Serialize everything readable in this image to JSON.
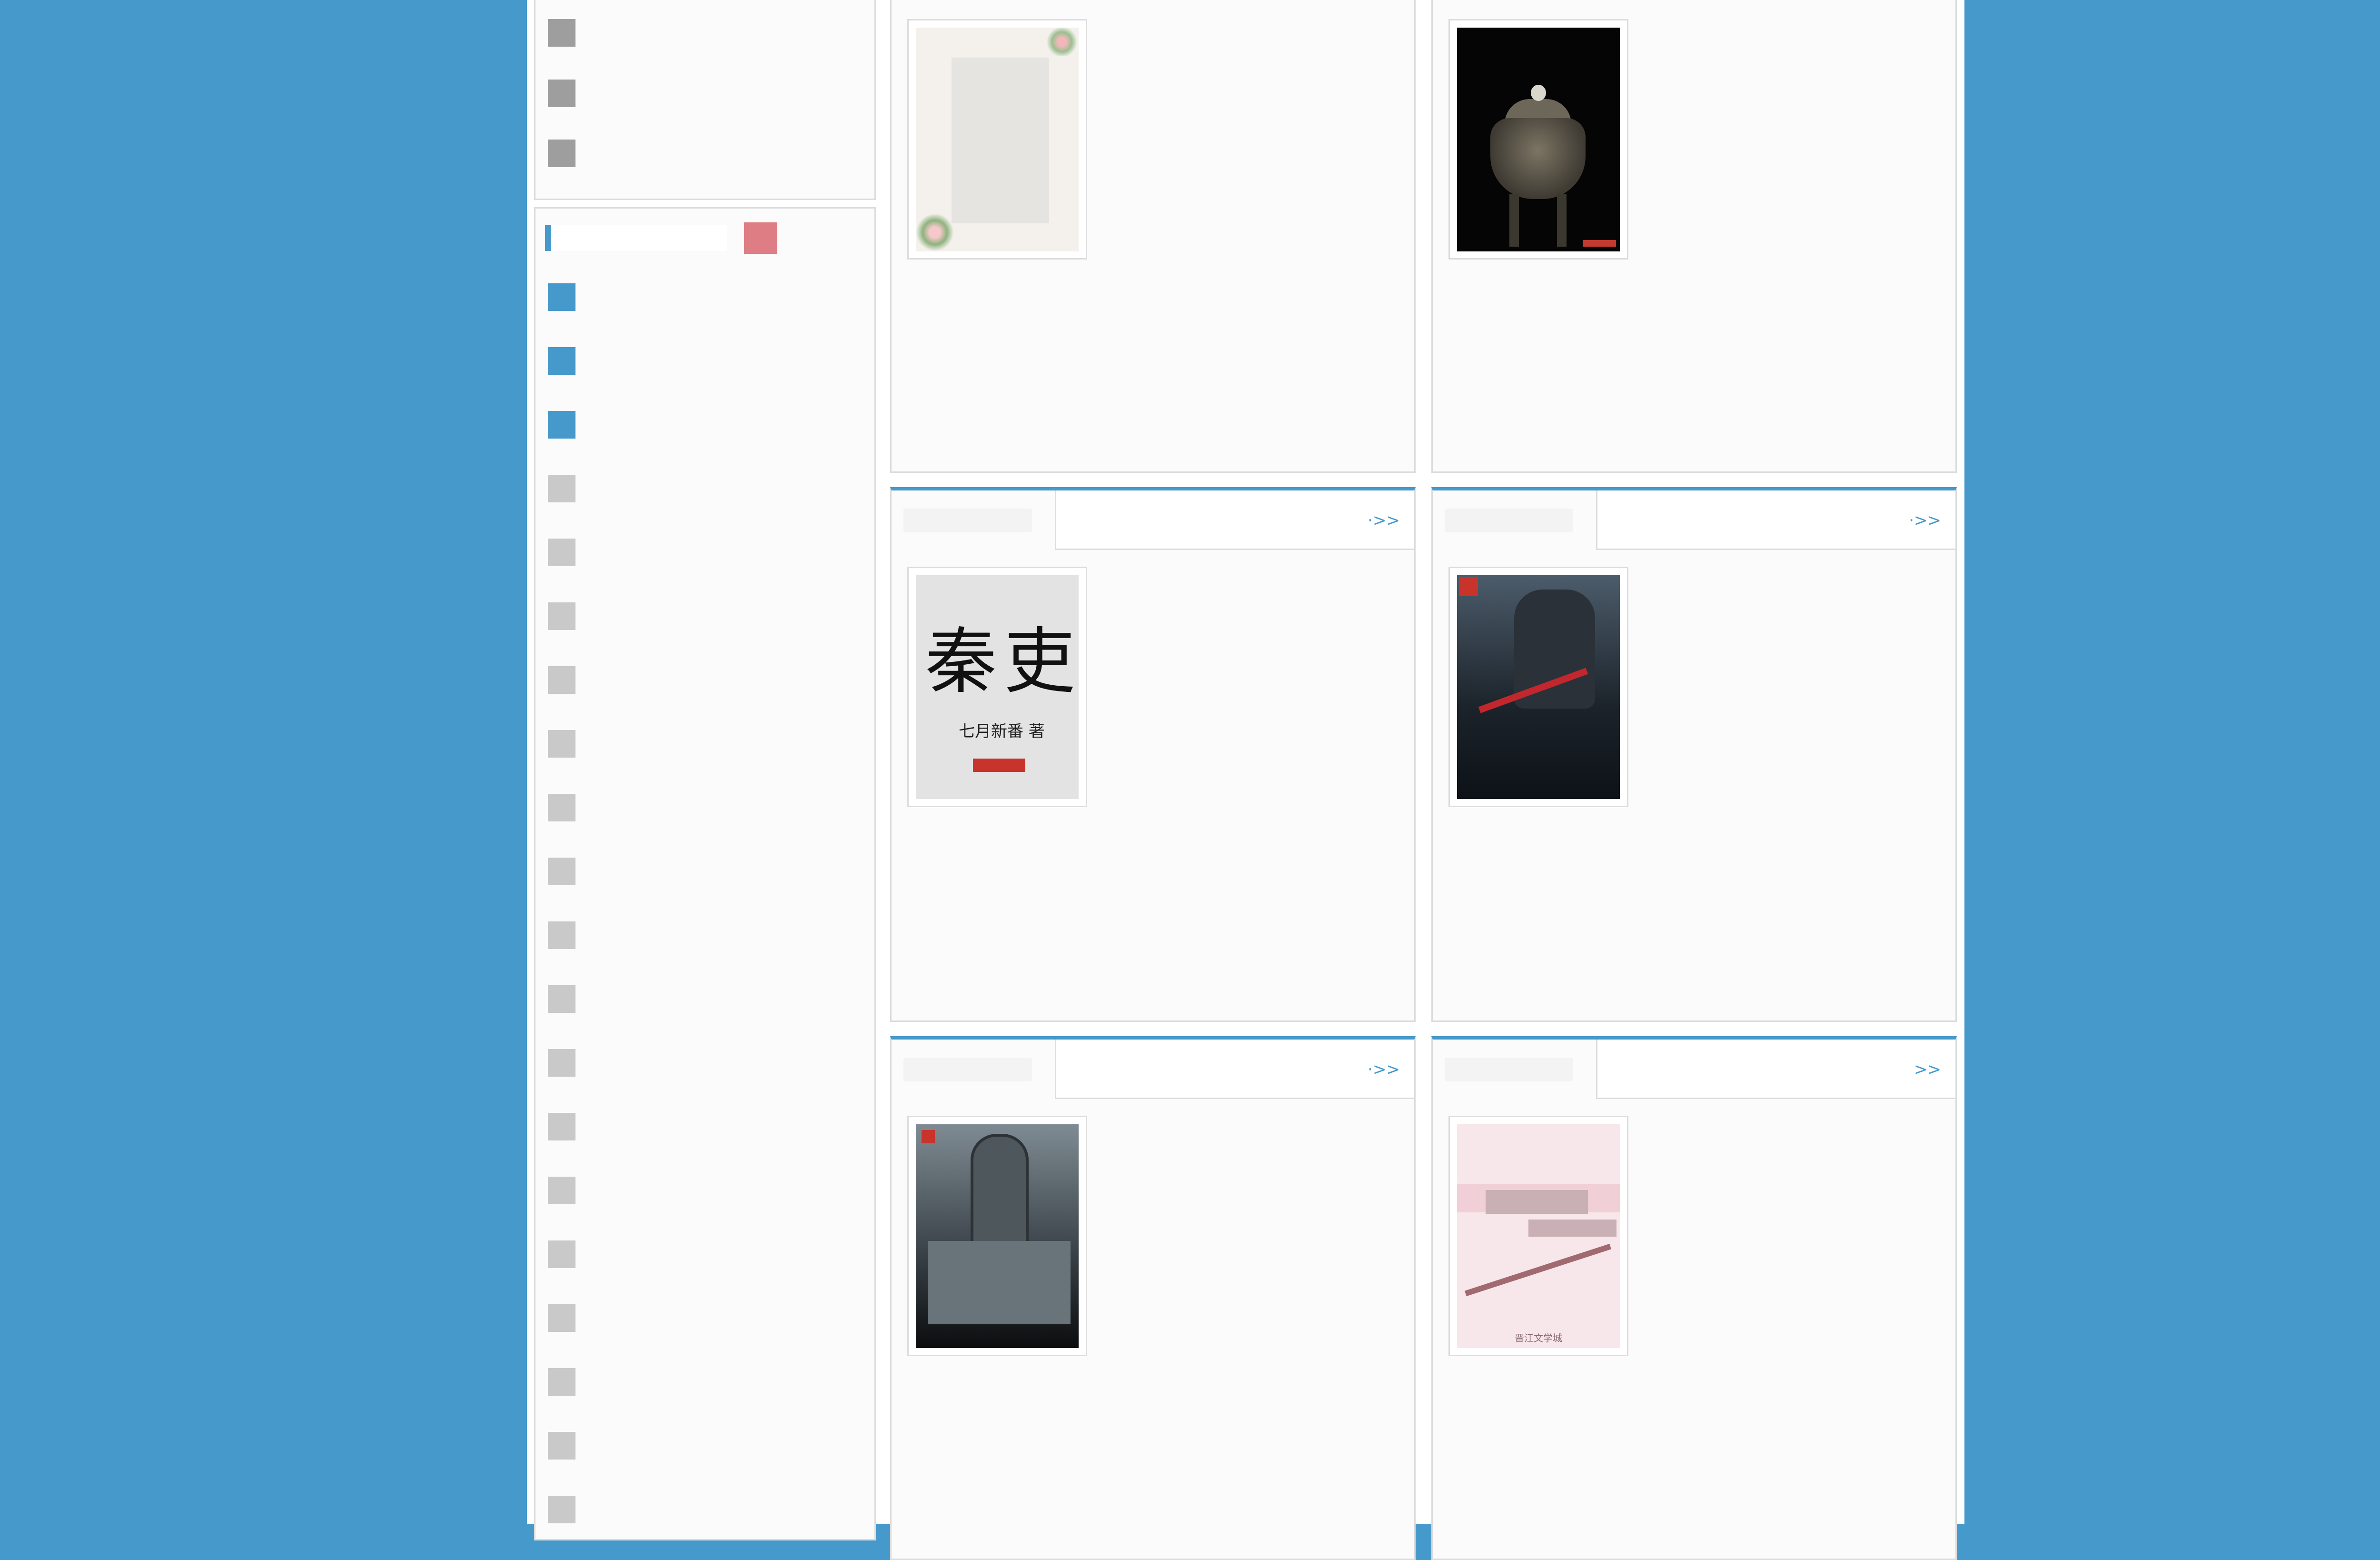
{
  "colors": {
    "background": "#4599cb",
    "accent": "#4599cb",
    "badge": "#df7d84"
  },
  "panels": [
    {
      "more_label": ""
    },
    {
      "more_label": ""
    },
    {
      "more_label": "·>>"
    },
    {
      "more_label": "·>>"
    },
    {
      "more_label": "·>>"
    },
    {
      "more_label": ">>"
    }
  ],
  "covers": {
    "seal_title_left": "秦",
    "seal_title_right": "吏",
    "seal_author": "七月新番 著",
    "blossom_caption": "晋江文学城"
  }
}
